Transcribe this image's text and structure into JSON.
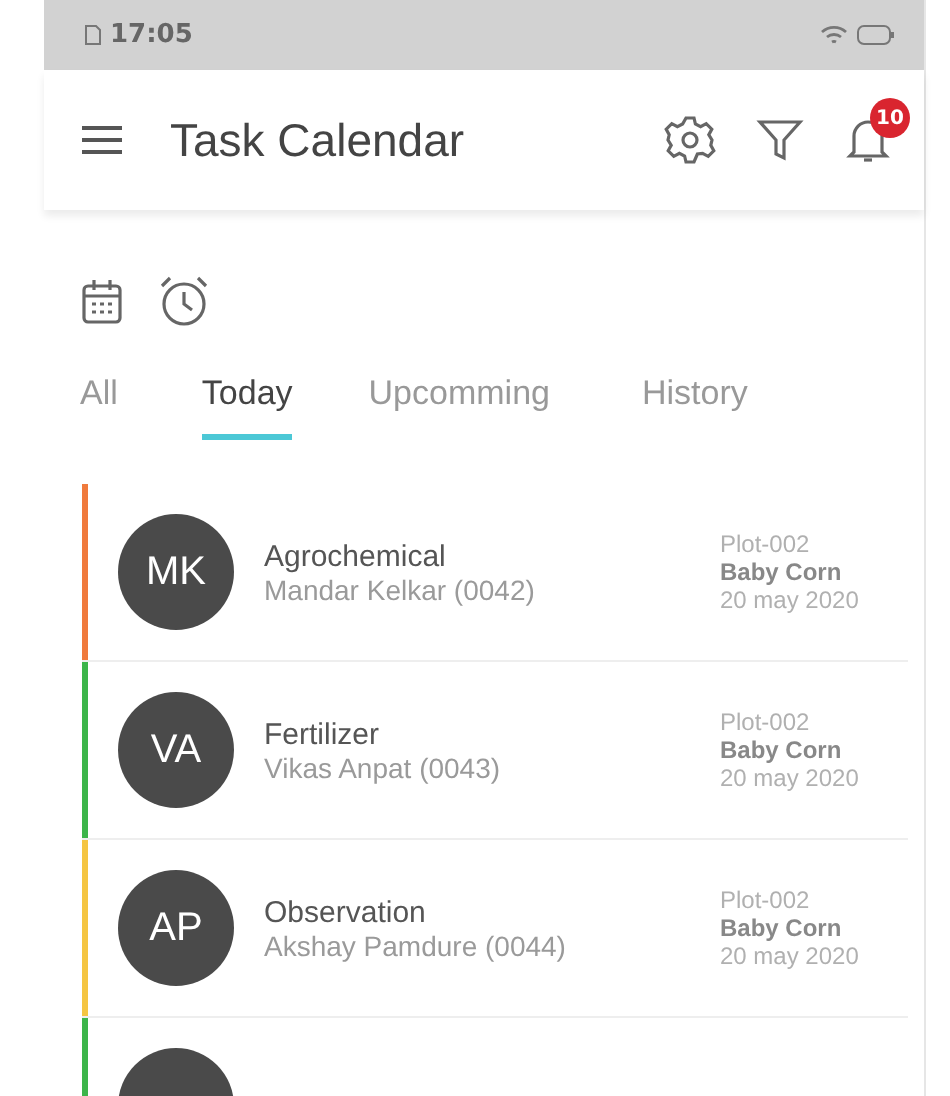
{
  "status_bar": {
    "time": "17:05"
  },
  "header": {
    "title": "Task Calendar",
    "notification_count": "10"
  },
  "tabs": [
    {
      "label": "All",
      "selected": false
    },
    {
      "label": "Today",
      "selected": true
    },
    {
      "label": "Upcomming",
      "selected": false
    },
    {
      "label": "History",
      "selected": false
    }
  ],
  "tasks": [
    {
      "color": "#f07a3c",
      "initials": "MK",
      "type": "Agrochemical",
      "person": "Mandar Kelkar (0042)",
      "plot": "Plot-002",
      "crop": "Baby Corn",
      "date": "20 may 2020"
    },
    {
      "color": "#3cb54a",
      "initials": "VA",
      "type": "Fertilizer",
      "person": "Vikas Anpat (0043)",
      "plot": "Plot-002",
      "crop": "Baby Corn",
      "date": "20 may 2020"
    },
    {
      "color": "#f5c542",
      "initials": "AP",
      "type": "Observation",
      "person": "Akshay Pamdure (0044)",
      "plot": "Plot-002",
      "crop": "Baby Corn",
      "date": "20 may 2020"
    },
    {
      "color": "#3cb54a"
    }
  ]
}
